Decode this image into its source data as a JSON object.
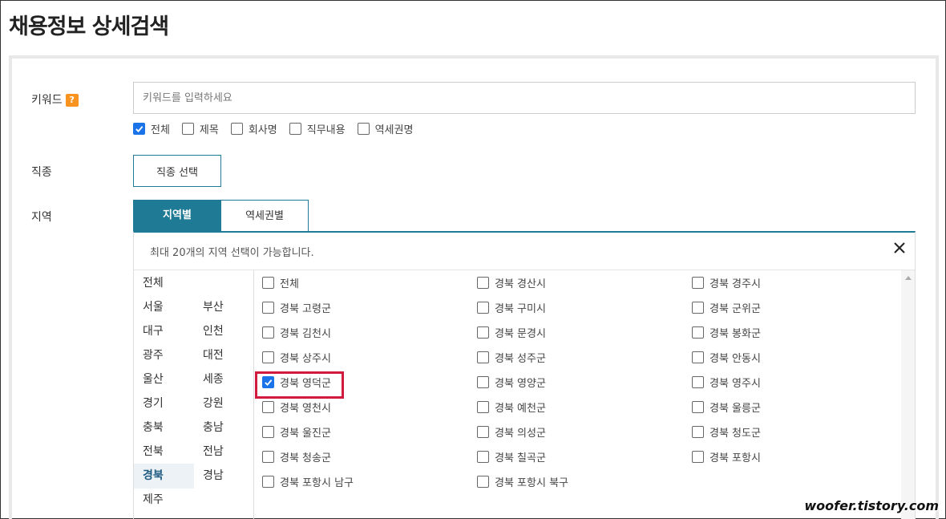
{
  "page_title": "채용정보 상세검색",
  "keyword": {
    "label": "키워드",
    "help_badge": "?",
    "placeholder": "키워드를 입력하세요",
    "value": "",
    "options": [
      {
        "label": "전체",
        "checked": true
      },
      {
        "label": "제목",
        "checked": false
      },
      {
        "label": "회사명",
        "checked": false
      },
      {
        "label": "직무내용",
        "checked": false
      },
      {
        "label": "역세권명",
        "checked": false
      }
    ]
  },
  "job_type": {
    "label": "직종",
    "button_label": "직종 선택"
  },
  "region": {
    "label": "지역",
    "tabs": [
      {
        "label": "지역별",
        "active": true
      },
      {
        "label": "역세권별",
        "active": false
      }
    ],
    "notice": "최대 20개의 지역 선택이 가능합니다.",
    "close_icon": "close-icon",
    "provinces": [
      {
        "label": "전체",
        "selected": false
      },
      {
        "label": "서울",
        "selected": false
      },
      {
        "label": "부산",
        "selected": false
      },
      {
        "label": "대구",
        "selected": false
      },
      {
        "label": "인천",
        "selected": false
      },
      {
        "label": "광주",
        "selected": false
      },
      {
        "label": "대전",
        "selected": false
      },
      {
        "label": "울산",
        "selected": false
      },
      {
        "label": "세종",
        "selected": false
      },
      {
        "label": "경기",
        "selected": false
      },
      {
        "label": "강원",
        "selected": false
      },
      {
        "label": "충북",
        "selected": false
      },
      {
        "label": "충남",
        "selected": false
      },
      {
        "label": "전북",
        "selected": false
      },
      {
        "label": "전남",
        "selected": false
      },
      {
        "label": "경북",
        "selected": true
      },
      {
        "label": "경남",
        "selected": false
      },
      {
        "label": "제주",
        "selected": false
      }
    ],
    "cities": [
      {
        "label": "전체",
        "checked": false
      },
      {
        "label": "경북 경산시",
        "checked": false
      },
      {
        "label": "경북 경주시",
        "checked": false
      },
      {
        "label": "경북 고령군",
        "checked": false
      },
      {
        "label": "경북 구미시",
        "checked": false
      },
      {
        "label": "경북 군위군",
        "checked": false
      },
      {
        "label": "경북 김천시",
        "checked": false
      },
      {
        "label": "경북 문경시",
        "checked": false
      },
      {
        "label": "경북 봉화군",
        "checked": false
      },
      {
        "label": "경북 상주시",
        "checked": false
      },
      {
        "label": "경북 성주군",
        "checked": false
      },
      {
        "label": "경북 안동시",
        "checked": false
      },
      {
        "label": "경북 영덕군",
        "checked": true
      },
      {
        "label": "경북 영양군",
        "checked": false
      },
      {
        "label": "경북 영주시",
        "checked": false
      },
      {
        "label": "경북 영천시",
        "checked": false
      },
      {
        "label": "경북 예천군",
        "checked": false
      },
      {
        "label": "경북 울릉군",
        "checked": false
      },
      {
        "label": "경북 울진군",
        "checked": false
      },
      {
        "label": "경북 의성군",
        "checked": false
      },
      {
        "label": "경북 청도군",
        "checked": false
      },
      {
        "label": "경북 청송군",
        "checked": false
      },
      {
        "label": "경북 칠곡군",
        "checked": false
      },
      {
        "label": "경북 포항시",
        "checked": false
      },
      {
        "label": "경북 포항시 남구",
        "checked": false
      },
      {
        "label": "경북 포항시 북구",
        "checked": false
      }
    ]
  },
  "colors": {
    "accent": "#1f7a96",
    "checkbox_checked": "#1a73e8",
    "highlight_box": "#d21a3e",
    "help_badge": "#f7931e"
  },
  "watermark": "woofer.tistory.com"
}
